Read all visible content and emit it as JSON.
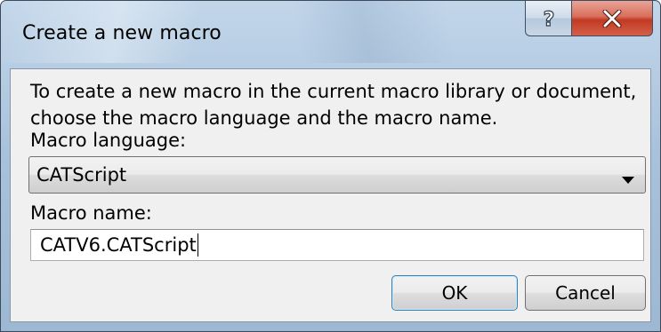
{
  "window": {
    "title": "Create a new macro",
    "help_icon": "question-mark-icon",
    "close_icon": "close-x-icon"
  },
  "dialog": {
    "instructions_line1": "To create a new macro in the current macro library or document,",
    "instructions_line2": "choose the macro language and the macro name.",
    "language_label": "Macro language:",
    "language_selected": "CATScript",
    "name_label": "Macro name:",
    "name_value": "CATV6.CATScript",
    "ok_label": "OK",
    "cancel_label": "Cancel"
  },
  "colors": {
    "close_button": "#c23a22",
    "frame": "#a9c2db",
    "client_background": "#f0f0f0",
    "default_button_border": "#3c7fb1"
  }
}
